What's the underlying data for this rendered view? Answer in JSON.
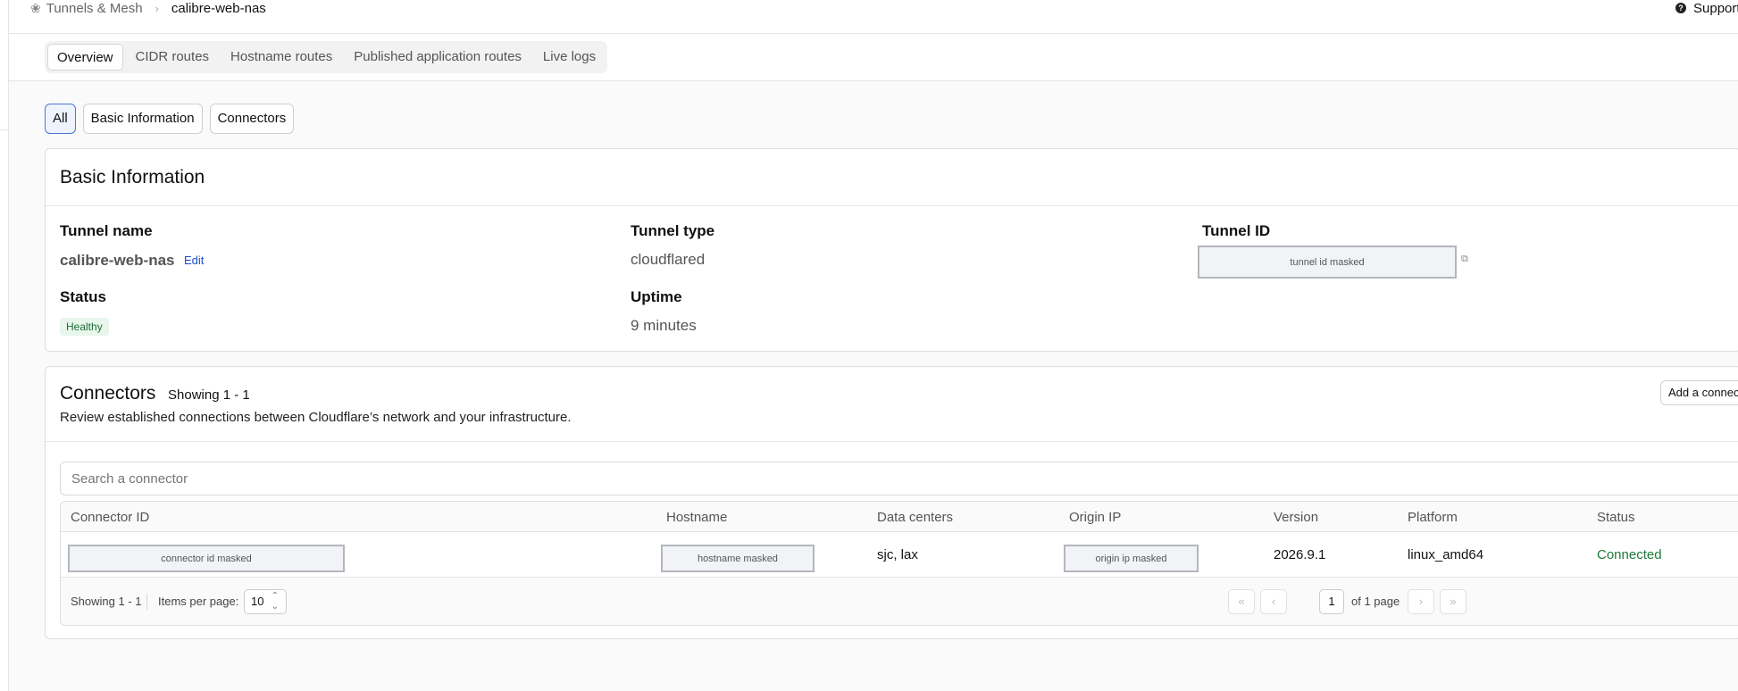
{
  "breadcrumb": {
    "parent": "Tunnels & Mesh",
    "current": "calibre-web-nas"
  },
  "support": {
    "label": "Support"
  },
  "tabs": [
    {
      "label": "Overview",
      "active": true
    },
    {
      "label": "CIDR routes"
    },
    {
      "label": "Hostname routes"
    },
    {
      "label": "Published application routes"
    },
    {
      "label": "Live logs"
    }
  ],
  "filters": [
    {
      "label": "All",
      "active": true
    },
    {
      "label": "Basic Information"
    },
    {
      "label": "Connectors"
    }
  ],
  "basic_info": {
    "title": "Basic Information",
    "tunnel_name_label": "Tunnel name",
    "tunnel_name": "calibre-web-nas",
    "edit_label": "Edit",
    "tunnel_type_label": "Tunnel type",
    "tunnel_type": "cloudflared",
    "tunnel_id_label": "Tunnel ID",
    "tunnel_id": "tunnel id masked",
    "status_label": "Status",
    "status": "Healthy",
    "uptime_label": "Uptime",
    "uptime": "9 minutes"
  },
  "connectors": {
    "title": "Connectors",
    "showing": "Showing 1 - 1",
    "description": "Review established connections between Cloudflare’s network and your infrastructure.",
    "add_button": "Add a connector",
    "search_placeholder": "Search a connector",
    "columns": [
      "Connector ID",
      "Hostname",
      "Data centers",
      "Origin IP",
      "Version",
      "Platform",
      "Status"
    ],
    "rows": [
      {
        "connector_id": "connector id masked",
        "hostname": "hostname masked",
        "data_centers": "sjc, lax",
        "origin_ip": "origin ip masked",
        "version": "2026.9.1",
        "platform": "linux_amd64",
        "status": "Connected"
      }
    ],
    "footer": {
      "showing": "Showing 1 - 1",
      "items_per_page_label": "Items per page:",
      "items_per_page": "10",
      "page": "1",
      "of_pages": "of 1 page"
    }
  },
  "colors": {
    "accent": "#1f4fc4",
    "success": "#1f7a3a"
  }
}
